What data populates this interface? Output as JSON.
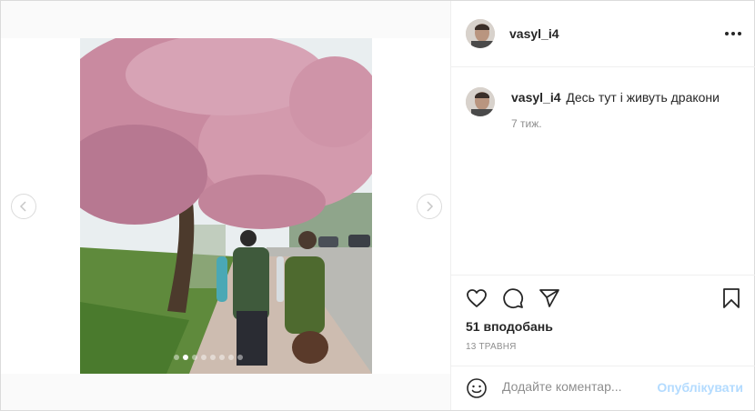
{
  "post": {
    "author": "vasyl_i4",
    "caption_author": "vasyl_i4",
    "caption": "Десь тут і живуть дракони",
    "caption_time": "7 тиж.",
    "likes": "51 вподобань",
    "date": "13 ТРАВНЯ"
  },
  "carousel": {
    "slide_count": 8,
    "active_index": 1
  },
  "comment_box": {
    "placeholder": "Додайте коментар...",
    "publish_label": "Опублікувати"
  },
  "icons": {
    "more": "more-options-icon",
    "like": "heart-icon",
    "comment": "comment-icon",
    "share": "share-icon",
    "save": "bookmark-icon",
    "emoji": "emoji-icon",
    "prev": "chevron-left-icon",
    "next": "chevron-right-icon"
  },
  "colors": {
    "text": "#262626",
    "secondary": "#8e8e8e",
    "border": "#dbdbdb",
    "publish_disabled": "#b3dbff"
  }
}
